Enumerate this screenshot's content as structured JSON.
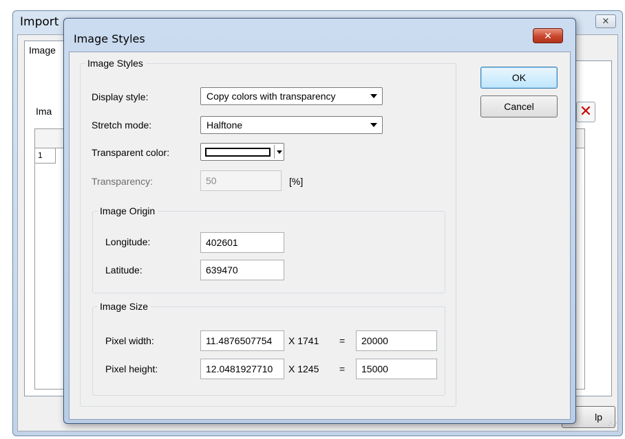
{
  "background_window": {
    "title": "Import",
    "close_glyph": "✕",
    "tab_label": "Image",
    "partial_label": "Ima",
    "grid_row_number": "1",
    "delete_glyph": "✕",
    "help_button_partial": "lp"
  },
  "dialog": {
    "title": "Image Styles",
    "close_glyph": "✕",
    "group_title": "Image Styles",
    "display_style": {
      "label": "Display style:",
      "value": "Copy colors with transparency"
    },
    "stretch_mode": {
      "label": "Stretch mode:",
      "value": "Halftone"
    },
    "transparent_color": {
      "label": "Transparent color:",
      "color": "#ffffff"
    },
    "transparency": {
      "label": "Transparency:",
      "value": "50",
      "unit": "[%]"
    },
    "image_origin": {
      "title": "Image Origin",
      "longitude_label": "Longitude:",
      "longitude_value": "402601",
      "latitude_label": "Latitude:",
      "latitude_value": "639470"
    },
    "image_size": {
      "title": "Image Size",
      "pixel_width_label": "Pixel width:",
      "pixel_width_value": "11.4876507754",
      "width_multiplier": "X 1741",
      "width_equals": "=",
      "width_total": "20000",
      "pixel_height_label": "Pixel height:",
      "pixel_height_value": "12.0481927710",
      "height_multiplier": "X 1245",
      "height_equals": "=",
      "height_total": "15000"
    },
    "ok_label": "OK",
    "cancel_label": "Cancel"
  }
}
